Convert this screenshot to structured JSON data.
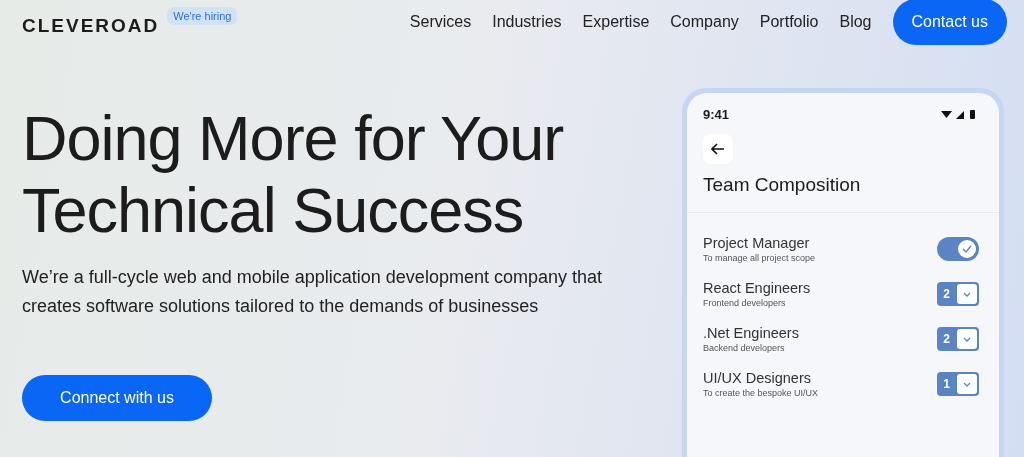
{
  "header": {
    "logo": "CLEVEROAD",
    "badge": "We're hiring",
    "nav": [
      {
        "label": "Services"
      },
      {
        "label": "Industries"
      },
      {
        "label": "Expertise"
      },
      {
        "label": "Company"
      },
      {
        "label": "Portfolio"
      },
      {
        "label": "Blog"
      }
    ],
    "cta": "Contact us"
  },
  "hero": {
    "title_lines": [
      "Doing More for Your",
      "Technical Success"
    ],
    "subtitle": "We’re a full-cycle web and mobile application development company that creates software solutions tailored to the demands of businesses",
    "button": "Connect with us"
  },
  "phone": {
    "time": "9:41",
    "title": "Team Composition",
    "rows": [
      {
        "kind": "toggle",
        "name": "Project Manager",
        "note": "To manage all project scope",
        "on": true
      },
      {
        "kind": "count",
        "name": "React Engineers",
        "note": "Frontend developers",
        "value": "2"
      },
      {
        "kind": "count",
        "name": ".Net Engineers",
        "note": "Backend developers",
        "value": "2"
      },
      {
        "kind": "count",
        "name": "UI/UX Designers",
        "note": "To create the bespoke UI/UX",
        "value": "1"
      }
    ]
  }
}
